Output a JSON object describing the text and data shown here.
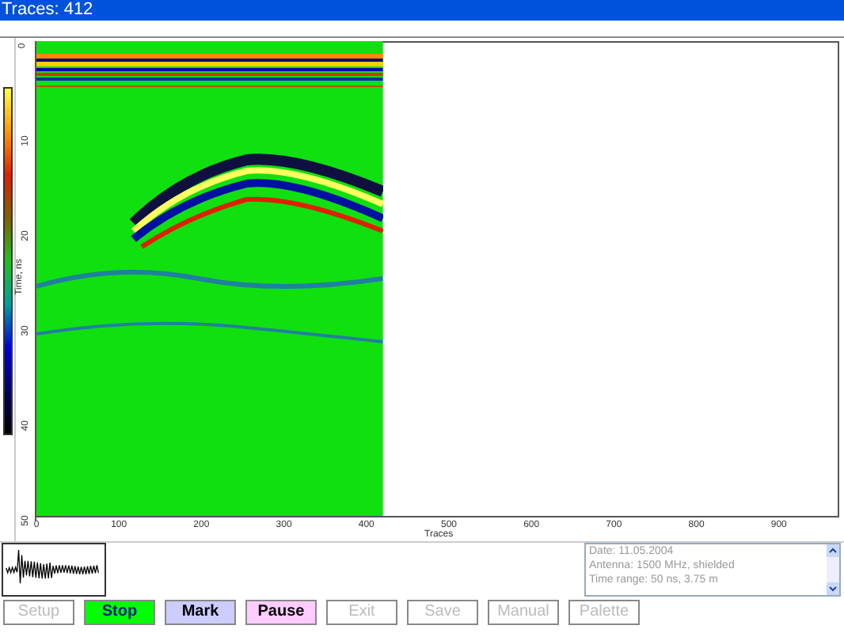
{
  "window": {
    "title": "Traces: 412"
  },
  "plot": {
    "y_ticks": [
      "0",
      "10",
      "20",
      "30",
      "40",
      "50"
    ],
    "ylabel": "Time, ns",
    "x_ticks": [
      "0",
      "100",
      "200",
      "300",
      "400",
      "500",
      "600",
      "700",
      "800",
      "900"
    ],
    "xlabel": "Traces",
    "level": 0.42
  },
  "info": {
    "lines": [
      "Date: 11.05.2004",
      "Antenna: 1500 MHz, shielded",
      "Time range: 50 ns, 3.75 m"
    ]
  },
  "buttons": [
    {
      "label": "Setup",
      "disabled": true
    },
    {
      "label": "Stop",
      "disabled": false,
      "color": "#00ff00"
    },
    {
      "label": "Mark",
      "disabled": false,
      "color": "#ccccff"
    },
    {
      "label": "Pause",
      "disabled": false,
      "color": "#ffccff"
    },
    {
      "label": "Exit",
      "disabled": true
    },
    {
      "label": "Save",
      "disabled": true
    },
    {
      "label": "Manual",
      "disabled": true
    },
    {
      "label": "Palette",
      "disabled": true
    }
  ]
}
